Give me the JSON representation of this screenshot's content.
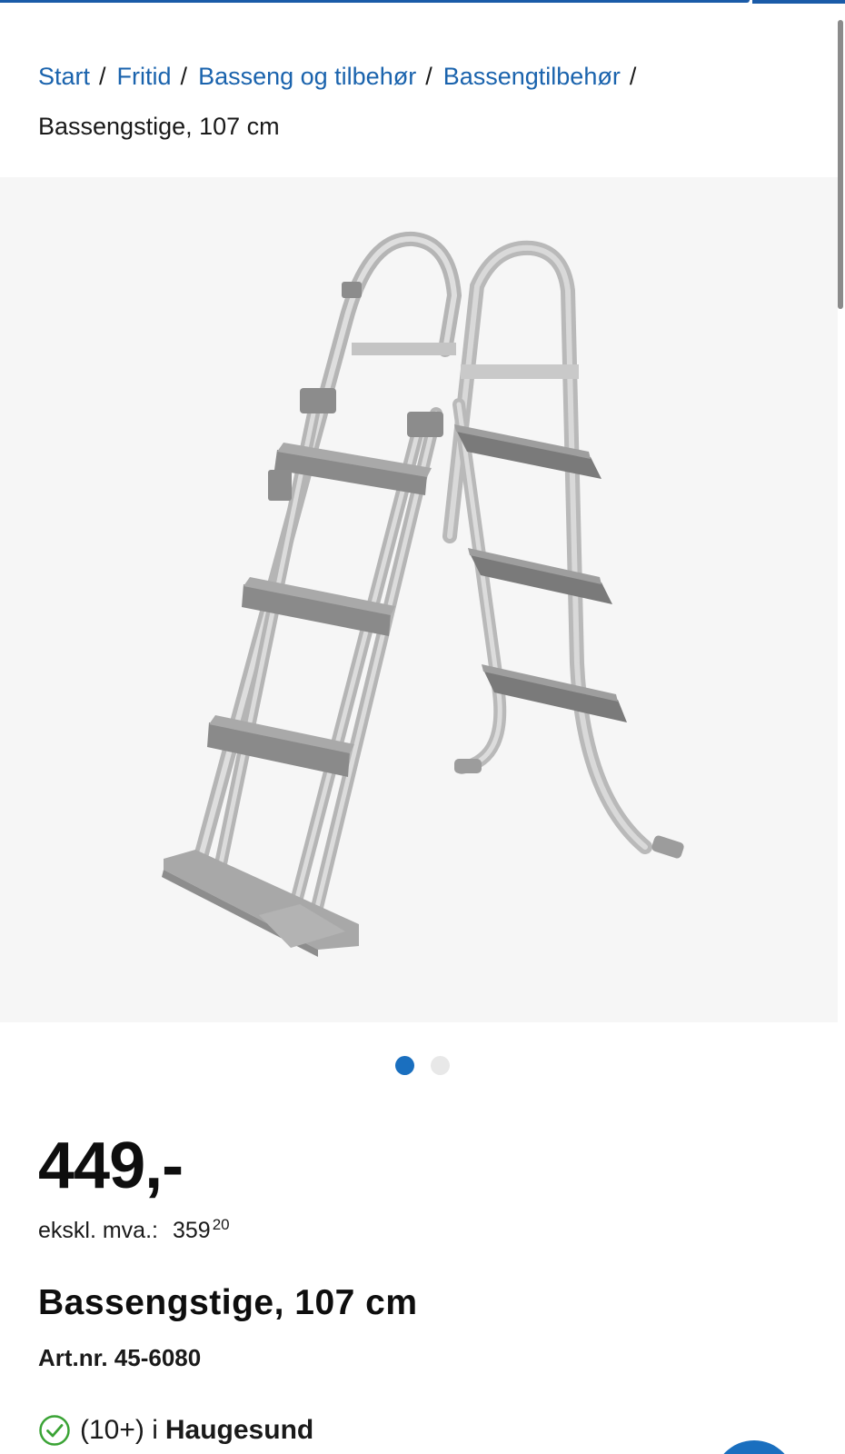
{
  "breadcrumb": {
    "items": [
      "Start",
      "Fritid",
      "Basseng og tilbehør",
      "Bassengtilbehør"
    ],
    "separator": "/",
    "current": "Bassengstige, 107 cm"
  },
  "gallery": {
    "image_alt": "ladder",
    "image_count": 2,
    "active_index": 0
  },
  "product": {
    "price": "449,-",
    "excl_vat_label": "ekskl. mva.:",
    "excl_vat_main": "359",
    "excl_vat_cents": "20",
    "title": "Bassengstige, 107 cm",
    "article_number": "Art.nr. 45-6080"
  },
  "stock": {
    "count_text": "(10+) i",
    "store": "Haugesund"
  },
  "colors": {
    "link": "#1a63ad",
    "accent": "#1a6fbf",
    "in_stock": "#3aa335"
  },
  "icons": [
    "check-circle-icon"
  ]
}
